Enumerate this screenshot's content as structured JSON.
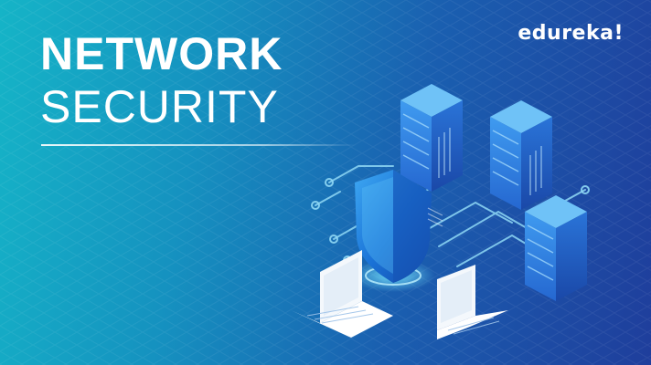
{
  "banner": {
    "title_line1": "NETWORK",
    "title_line2": "SECURITY",
    "logo_text": "edureka!"
  },
  "colors": {
    "gradient_start": "#15b4c7",
    "gradient_end": "#1f3e9c",
    "server_face": "#2f7fe0",
    "server_side": "#1e55b8",
    "shield": "#1b6fd6",
    "circuit": "#8fd8f5"
  },
  "icons": [
    "server-icon",
    "shield-icon",
    "laptop-icon",
    "circuit-lines"
  ]
}
